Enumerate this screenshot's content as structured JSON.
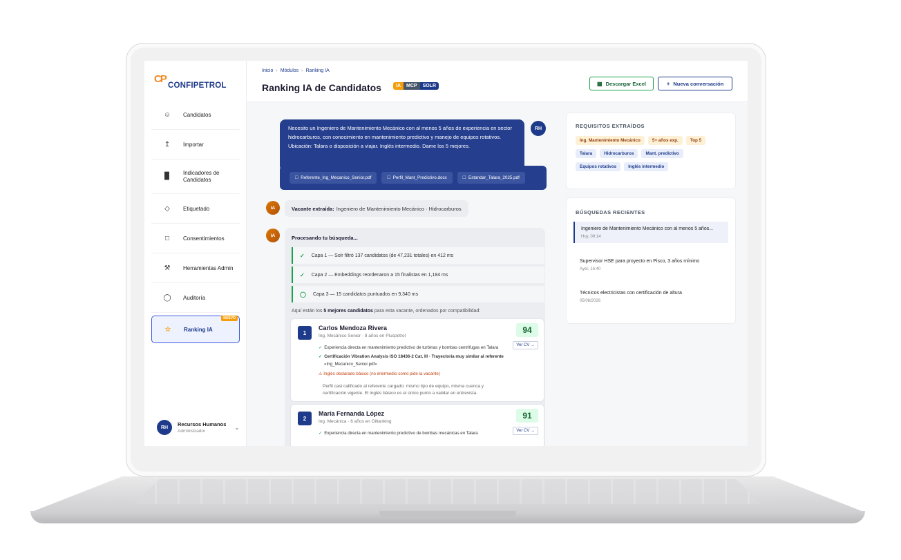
{
  "brand": {
    "name": "CONFIPETROL",
    "mark": "CP"
  },
  "sidebar": {
    "items": [
      {
        "label": "Candidatos",
        "icon": "user-icon"
      },
      {
        "label": "Importar",
        "icon": "upload-icon"
      },
      {
        "label": "Indicadores de Candidatos",
        "icon": "bar-chart-icon"
      },
      {
        "label": "Etiquetado",
        "icon": "tag-icon"
      },
      {
        "label": "Consentimientos",
        "icon": "document-icon"
      },
      {
        "label": "Herramientas Admin",
        "icon": "wrench-icon"
      },
      {
        "label": "Auditoría",
        "icon": "shield-icon"
      },
      {
        "label": "Ranking IA",
        "icon": "star-icon",
        "badge": "NUEVO"
      }
    ],
    "user": {
      "initials": "RH",
      "name": "Recursos Humanos",
      "role": "Administrador"
    }
  },
  "header": {
    "breadcrumb": [
      "Inicio",
      "Módulos",
      "Ranking IA"
    ],
    "title": "Ranking IA de Candidatos",
    "tags": [
      "IA",
      "MCP",
      "SOLR"
    ],
    "excel_label": "Descargar Excel",
    "new_label": "Nueva conversación"
  },
  "chat": {
    "user_initials": "RH",
    "user_message": "Necesito un Ingeniero de Mantenimiento Mecánico con al menos 5 años de experiencia en sector hidrocarburos, con conocimiento en mantenimiento predictivo y manejo de equipos rotativos. Ubicación: Talara o disposición a viajar. Inglés intermedio. Dame los 5 mejores.",
    "attachments": [
      "Referente_Ing_Mecanico_Senior.pdf",
      "Perfil_Mant_Predictivo.docx",
      "Estandar_Talara_2025.pdf"
    ],
    "ai_initials": "IA",
    "vacante_label": "Vacante extraída:",
    "vacante_value": "Ingeniero de Mantenimiento Mecánico · Hidrocarburos",
    "processing_title": "Procesando tu búsqueda...",
    "layers": [
      "Capa 1 — Solr filtró 137 candidatos (de 47,231 totales) en 412 ms",
      "Capa 2 — Embeddings reordenaron a 15 finalistas en 1,184 ms",
      "Capa 3 — 15 candidatos puntuados en 9,340 ms"
    ],
    "intro_pre": "Aquí están los",
    "intro_bold": "5 mejores candidatos",
    "intro_post": "para esta vacante, ordenados por compatibilidad:",
    "candidates": [
      {
        "rank": "1",
        "name": "Carlos Mendoza Rivera",
        "role": "Ing. Mecánico Senior · 8 años en Pluspetrol",
        "score": "94",
        "cv_label": "Ver CV →",
        "bullets": [
          "Experiencia directa en mantenimiento predictivo de turbinas y bombas centrífugas en Talara",
          "Certificación Vibration Analysis ISO 18436-2 Cat. III · Trayectoria muy similar al referente",
          "«Ing_Mecanico_Senior.pdf»"
        ],
        "warning": "Inglés declarado básico (no intermedio como pide la vacante)",
        "note": "Perfil casi calificado al referente cargado: mismo tipo de equipo, misma cuenca y certificación vigente. El inglés básico es el único punto a validar en entrevista."
      },
      {
        "rank": "2",
        "name": "María Fernanda López",
        "role": "Ing. Mecánica · 6 años en Oiltanking",
        "score": "91",
        "cv_label": "Ver CV →",
        "bullets": [
          "Experiencia directa en mantenimiento predictivo de bombas mecánicas en Talara"
        ]
      }
    ]
  },
  "requirements": {
    "title": "REQUISITOS EXTRAÍDOS",
    "chips": [
      {
        "label": "Ing. Mantenimiento Mecánico",
        "tone": "orange"
      },
      {
        "label": "5+ años exp.",
        "tone": "orange"
      },
      {
        "label": "Top 5",
        "tone": "orange"
      },
      {
        "label": "Talara",
        "tone": "blue"
      },
      {
        "label": "Hidrocarburos",
        "tone": "blue"
      },
      {
        "label": "Mant. predictivo",
        "tone": "blue"
      },
      {
        "label": "Equipos rotativos",
        "tone": "blue"
      },
      {
        "label": "Inglés intermedio",
        "tone": "blue"
      }
    ]
  },
  "recent": {
    "title": "BÚSQUEDAS RECIENTES",
    "items": [
      {
        "text": "Ingeniero de Mantenimiento Mecánico con al menos 5 años...",
        "time": "Hoy, 09:14"
      },
      {
        "text": "Supervisor HSE para proyecto en Pisco, 3 años mínimo",
        "time": "Ayer, 16:40"
      },
      {
        "text": "Técnicos electricistas con certificación de altura",
        "time": "05/08/2026"
      }
    ]
  }
}
